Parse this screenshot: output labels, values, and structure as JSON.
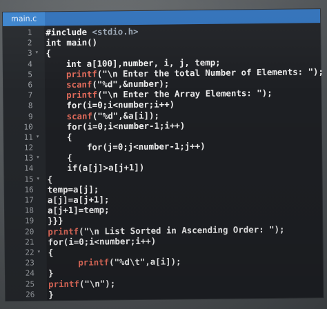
{
  "tab": {
    "filename": "main.c"
  },
  "lines": [
    {
      "n": "1",
      "fold": "",
      "indent": 0,
      "tokens": [
        [
          "pp",
          "#include "
        ],
        [
          "hdr",
          "<stdio.h>"
        ]
      ]
    },
    {
      "n": "2",
      "fold": "",
      "indent": 0,
      "tokens": [
        [
          "k",
          "int main()"
        ]
      ]
    },
    {
      "n": "3",
      "fold": "▾",
      "indent": 0,
      "tokens": [
        [
          "k",
          "{"
        ]
      ]
    },
    {
      "n": "4",
      "fold": "",
      "indent": 2,
      "tokens": [
        [
          "k",
          "int a[100],number, i, j, temp;"
        ]
      ]
    },
    {
      "n": "5",
      "fold": "",
      "indent": 2,
      "tokens": [
        [
          "fn",
          "printf"
        ],
        [
          "str",
          "(\"\\n Enter the total Number of Elements: \");"
        ]
      ]
    },
    {
      "n": "6",
      "fold": "",
      "indent": 2,
      "tokens": [
        [
          "fn",
          "scanf"
        ],
        [
          "str",
          "(\"%d\",&number);"
        ]
      ]
    },
    {
      "n": "7",
      "fold": "",
      "indent": 2,
      "tokens": [
        [
          "fn",
          "printf"
        ],
        [
          "str",
          "(\"\\n Enter the Array Elements: \");"
        ]
      ]
    },
    {
      "n": "8",
      "fold": "",
      "indent": 2,
      "tokens": [
        [
          "k",
          "for(i=0;i<number;i++)"
        ]
      ]
    },
    {
      "n": "9",
      "fold": "",
      "indent": 2,
      "tokens": [
        [
          "fn",
          "scanf"
        ],
        [
          "str",
          "(\"%d\",&a[i]);"
        ]
      ]
    },
    {
      "n": "10",
      "fold": "",
      "indent": 2,
      "tokens": [
        [
          "k",
          "for(i=0;i<number-1;i++)"
        ]
      ]
    },
    {
      "n": "11",
      "fold": "▾",
      "indent": 2,
      "tokens": [
        [
          "k",
          "{"
        ]
      ]
    },
    {
      "n": "12",
      "fold": "",
      "indent": 4,
      "tokens": [
        [
          "k",
          "for(j=0;j<number-1;j++)"
        ]
      ]
    },
    {
      "n": "13",
      "fold": "▾",
      "indent": 2,
      "tokens": [
        [
          "k",
          "{"
        ]
      ]
    },
    {
      "n": "14",
      "fold": "",
      "indent": 2,
      "tokens": [
        [
          "k",
          "if(a[j]>a[j+1])"
        ]
      ]
    },
    {
      "n": "15",
      "fold": "▾",
      "indent": 0,
      "tokens": [
        [
          "k",
          "{"
        ]
      ]
    },
    {
      "n": "16",
      "fold": "",
      "indent": 0,
      "tokens": [
        [
          "k",
          "temp=a[j];"
        ]
      ]
    },
    {
      "n": "17",
      "fold": "",
      "indent": 0,
      "tokens": [
        [
          "k",
          "a[j]=a[j+1];"
        ]
      ]
    },
    {
      "n": "18",
      "fold": "",
      "indent": 0,
      "tokens": [
        [
          "k",
          "a[j+1]=temp;"
        ]
      ]
    },
    {
      "n": "19",
      "fold": "",
      "indent": 0,
      "tokens": [
        [
          "k",
          "}}}"
        ]
      ]
    },
    {
      "n": "20",
      "fold": "",
      "indent": 0,
      "tokens": [
        [
          "fn",
          "printf"
        ],
        [
          "str",
          "(\"\\n List Sorted in Ascending Order: \");"
        ]
      ]
    },
    {
      "n": "21",
      "fold": "",
      "indent": 0,
      "tokens": [
        [
          "k",
          "for(i=0;i<number;i++)"
        ]
      ]
    },
    {
      "n": "22",
      "fold": "▾",
      "indent": 0,
      "tokens": [
        [
          "k",
          "{"
        ]
      ]
    },
    {
      "n": "23",
      "fold": "",
      "indent": 3,
      "tokens": [
        [
          "fn",
          "printf"
        ],
        [
          "str",
          "(\"%d\\t\",a[i]);"
        ]
      ]
    },
    {
      "n": "24",
      "fold": "",
      "indent": 0,
      "tokens": [
        [
          "k",
          "}"
        ]
      ]
    },
    {
      "n": "25",
      "fold": "",
      "indent": 0,
      "tokens": [
        [
          "fn",
          "printf"
        ],
        [
          "str",
          "(\"\\n\");"
        ]
      ]
    },
    {
      "n": "26",
      "fold": "",
      "indent": 0,
      "tokens": [
        [
          "k",
          "}"
        ]
      ]
    }
  ],
  "colors": {
    "tabbar": "#2e6fb8",
    "editor_bg": "#1d1f23",
    "function": "#e06a5a"
  }
}
